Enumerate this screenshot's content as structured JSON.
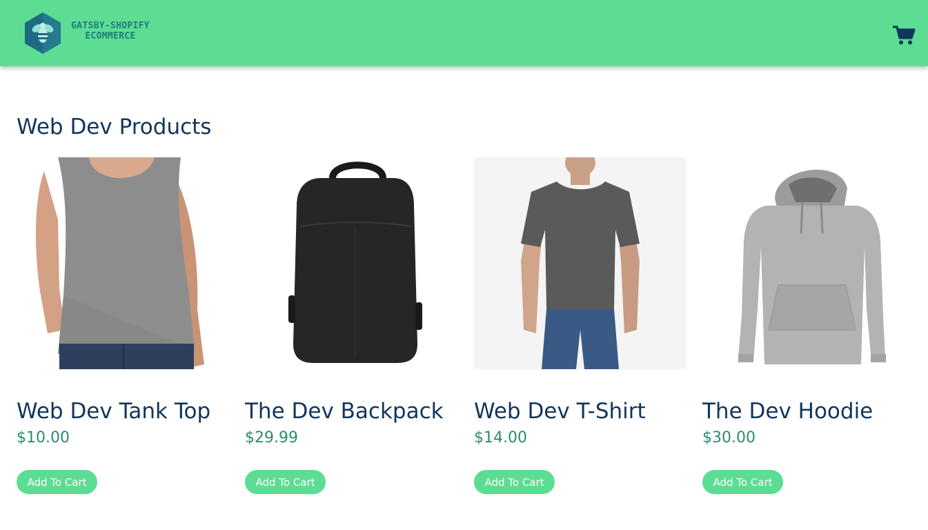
{
  "header": {
    "logo_line1": "GATSBY-SHOPIFY",
    "logo_line2": "ECOMMERCE",
    "logo_icon": "bee-hexagon-logo",
    "cart_icon": "shopping-cart-icon"
  },
  "page_title": "Web Dev Products",
  "products": [
    {
      "title": "Web Dev Tank Top",
      "price": "$10.00",
      "button": "Add To Cart",
      "image": "gray tank top on model"
    },
    {
      "title": "The Dev Backpack",
      "price": "$29.99",
      "button": "Add To Cart",
      "image": "black backpack"
    },
    {
      "title": "Web Dev T-Shirt",
      "price": "$14.00",
      "button": "Add To Cart",
      "image": "gray t-shirt on model"
    },
    {
      "title": "The Dev Hoodie",
      "price": "$30.00",
      "button": "Add To Cart",
      "image": "gray hoodie"
    }
  ],
  "colors": {
    "header_bg": "#5cdd93",
    "title_text": "#12355b",
    "price_text": "#2f8a71",
    "button_bg": "#5cdd93"
  }
}
